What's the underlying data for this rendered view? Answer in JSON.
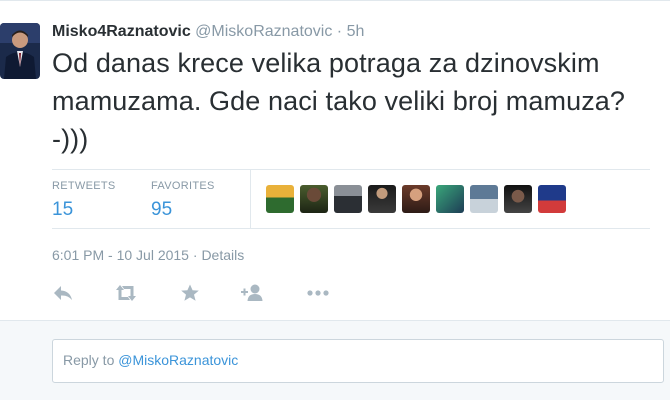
{
  "tweet": {
    "fullname": "Misko4Raznatovic",
    "username": "@MiskoRaznatovic",
    "separator": "·",
    "time_ago": "5h",
    "text": "Od danas krece velika potraga za dzinovskim mamuzama. Gde naci tako veliki broj mamuza? -)))",
    "stats": {
      "retweets_label": "RETWEETS",
      "retweets_count": "15",
      "favorites_label": "FAVORITES",
      "favorites_count": "95"
    },
    "favoriter_avatar_count": 9,
    "meta": {
      "timestamp": "6:01 PM - 10 Jul 2015",
      "separator": "·",
      "details_link": "Details"
    },
    "actions": [
      {
        "name": "reply-icon"
      },
      {
        "name": "retweet-icon"
      },
      {
        "name": "favorite-icon"
      },
      {
        "name": "follow-icon"
      },
      {
        "name": "more-icon"
      }
    ]
  },
  "reply": {
    "prefix": "Reply to ",
    "mention": "@MiskoRaznatovic"
  },
  "colors": {
    "link_blue": "#3b94d9",
    "text_dark": "#292f33",
    "text_gray": "#8899a6",
    "border": "#e1e8ed",
    "icon_gray": "#aab8c2",
    "reply_bg": "#f5f8fa"
  }
}
